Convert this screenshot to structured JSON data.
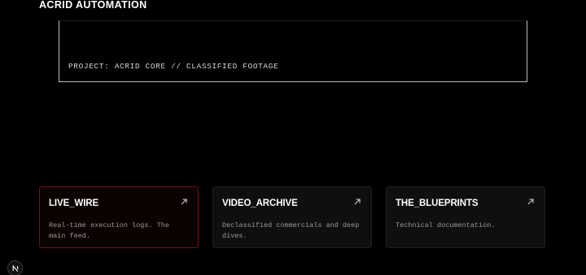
{
  "header": {
    "brand": "ACRID AUTOMATION"
  },
  "hero": {
    "caption": "PROJECT: ACRID CORE // CLASSIFIED FOOTAGE"
  },
  "cards": [
    {
      "title": "LIVE_WIRE",
      "description": "Real-time execution logs. The main feed.",
      "icon": "arrow-up-right-icon",
      "active": true
    },
    {
      "title": "VIDEO_ARCHIVE",
      "description": "Declassified commercials and deep dives.",
      "icon": "arrow-up-right-icon",
      "active": false
    },
    {
      "title": "THE_BLUEPRINTS",
      "description": "Technical documentation.",
      "icon": "arrow-up-right-icon",
      "active": false
    }
  ],
  "badge": {
    "label": "N",
    "icon": "nextjs-logo-icon"
  },
  "colors": {
    "background": "#000000",
    "accent": "#7a0d10",
    "card": "#0f0f0f",
    "text": "#ffffff",
    "muted": "#9a9a9a"
  }
}
